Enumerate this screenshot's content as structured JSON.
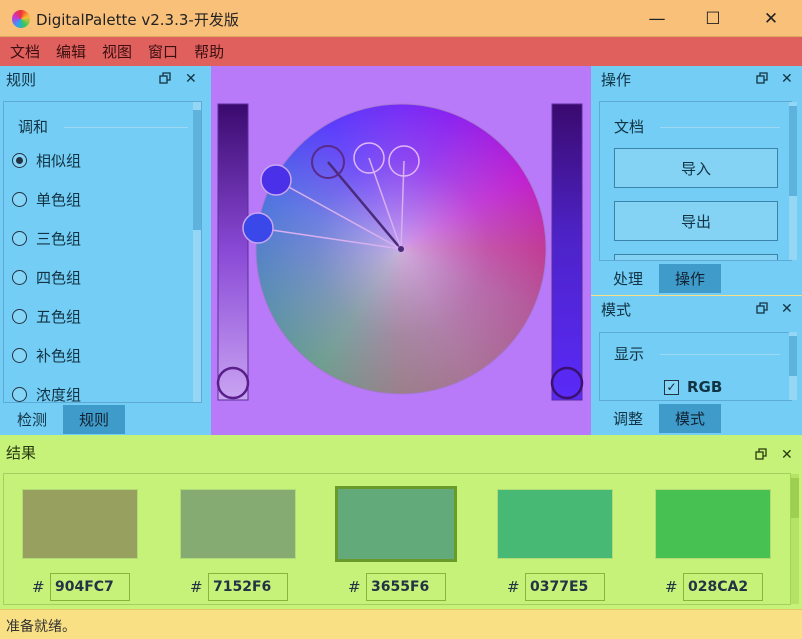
{
  "window": {
    "title": "DigitalPalette v2.3.3-开发版",
    "minimize_glyph": "—",
    "maximize_glyph": "☐",
    "close_glyph": "✕"
  },
  "menu": [
    "文档",
    "编辑",
    "视图",
    "窗口",
    "帮助"
  ],
  "rules_dock": {
    "title": "规则",
    "group_label": "调和",
    "options": [
      {
        "label": "相似组",
        "selected": true
      },
      {
        "label": "单色组",
        "selected": false
      },
      {
        "label": "三色组",
        "selected": false
      },
      {
        "label": "四色组",
        "selected": false
      },
      {
        "label": "五色组",
        "selected": false
      },
      {
        "label": "补色组",
        "selected": false
      },
      {
        "label": "浓度组",
        "selected": false
      }
    ],
    "tabs": [
      "检测",
      "规则"
    ],
    "active_tab": "规则"
  },
  "operation_dock": {
    "title": "操作",
    "group_label": "文档",
    "buttons": [
      "导入",
      "导出"
    ],
    "tabs": [
      "处理",
      "操作"
    ],
    "active_tab": "操作"
  },
  "mode_dock": {
    "title": "模式",
    "group_label": "显示",
    "checkbox_label": "RGB",
    "checkbox_checked": true,
    "tabs": [
      "调整",
      "模式"
    ],
    "active_tab": "模式"
  },
  "result_dock": {
    "title": "结果",
    "hash": "#",
    "swatches": [
      {
        "hex": "904FC7",
        "color": "#97a05e",
        "selected": false
      },
      {
        "hex": "7152F6",
        "color": "#86ab72",
        "selected": false
      },
      {
        "hex": "3655F6",
        "color": "#62aa7a",
        "selected": true
      },
      {
        "hex": "0377E5",
        "color": "#48b974",
        "selected": false
      },
      {
        "hex": "028CA2",
        "color": "#47c252",
        "selected": false
      }
    ]
  },
  "status": "准备就绪。",
  "icons": {
    "float": "float-icon",
    "close": "close-icon",
    "check": "✓"
  },
  "colors": {
    "titlebar": "#f9c07a",
    "menubar": "#e0605e",
    "dock": "#74cdf4",
    "workspace": "#b87af8",
    "result": "#c6f27a",
    "status": "#f9e084"
  }
}
